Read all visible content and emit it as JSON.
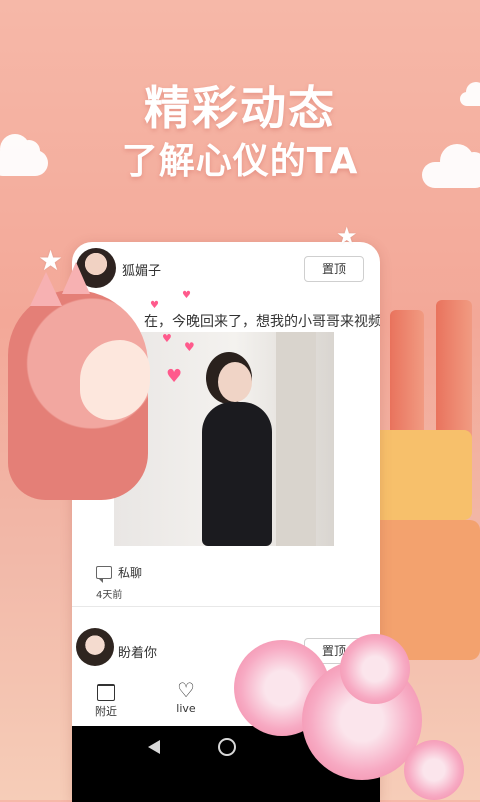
{
  "headline": {
    "line1": "精彩动态",
    "line2": "了解心仪的TA"
  },
  "post1": {
    "username": "狐媚子",
    "pin_label": "置顶",
    "text": "在，今晚回来了，想我的小哥哥来视频",
    "action_label": "私聊",
    "time": "4天前"
  },
  "post2": {
    "username": "盼着你",
    "pin_label": "置顶"
  },
  "tabbar": {
    "tabs": [
      {
        "label": "附近",
        "icon": "home-icon"
      },
      {
        "label": "live",
        "icon": "heart-ta-icon"
      }
    ]
  },
  "navbar": {
    "icons": [
      "back-icon",
      "home-icon"
    ]
  },
  "colors": {
    "background": "#f3a898",
    "headline_text": "#ffffff",
    "card": "#ffffff",
    "navbar": "#000000"
  }
}
